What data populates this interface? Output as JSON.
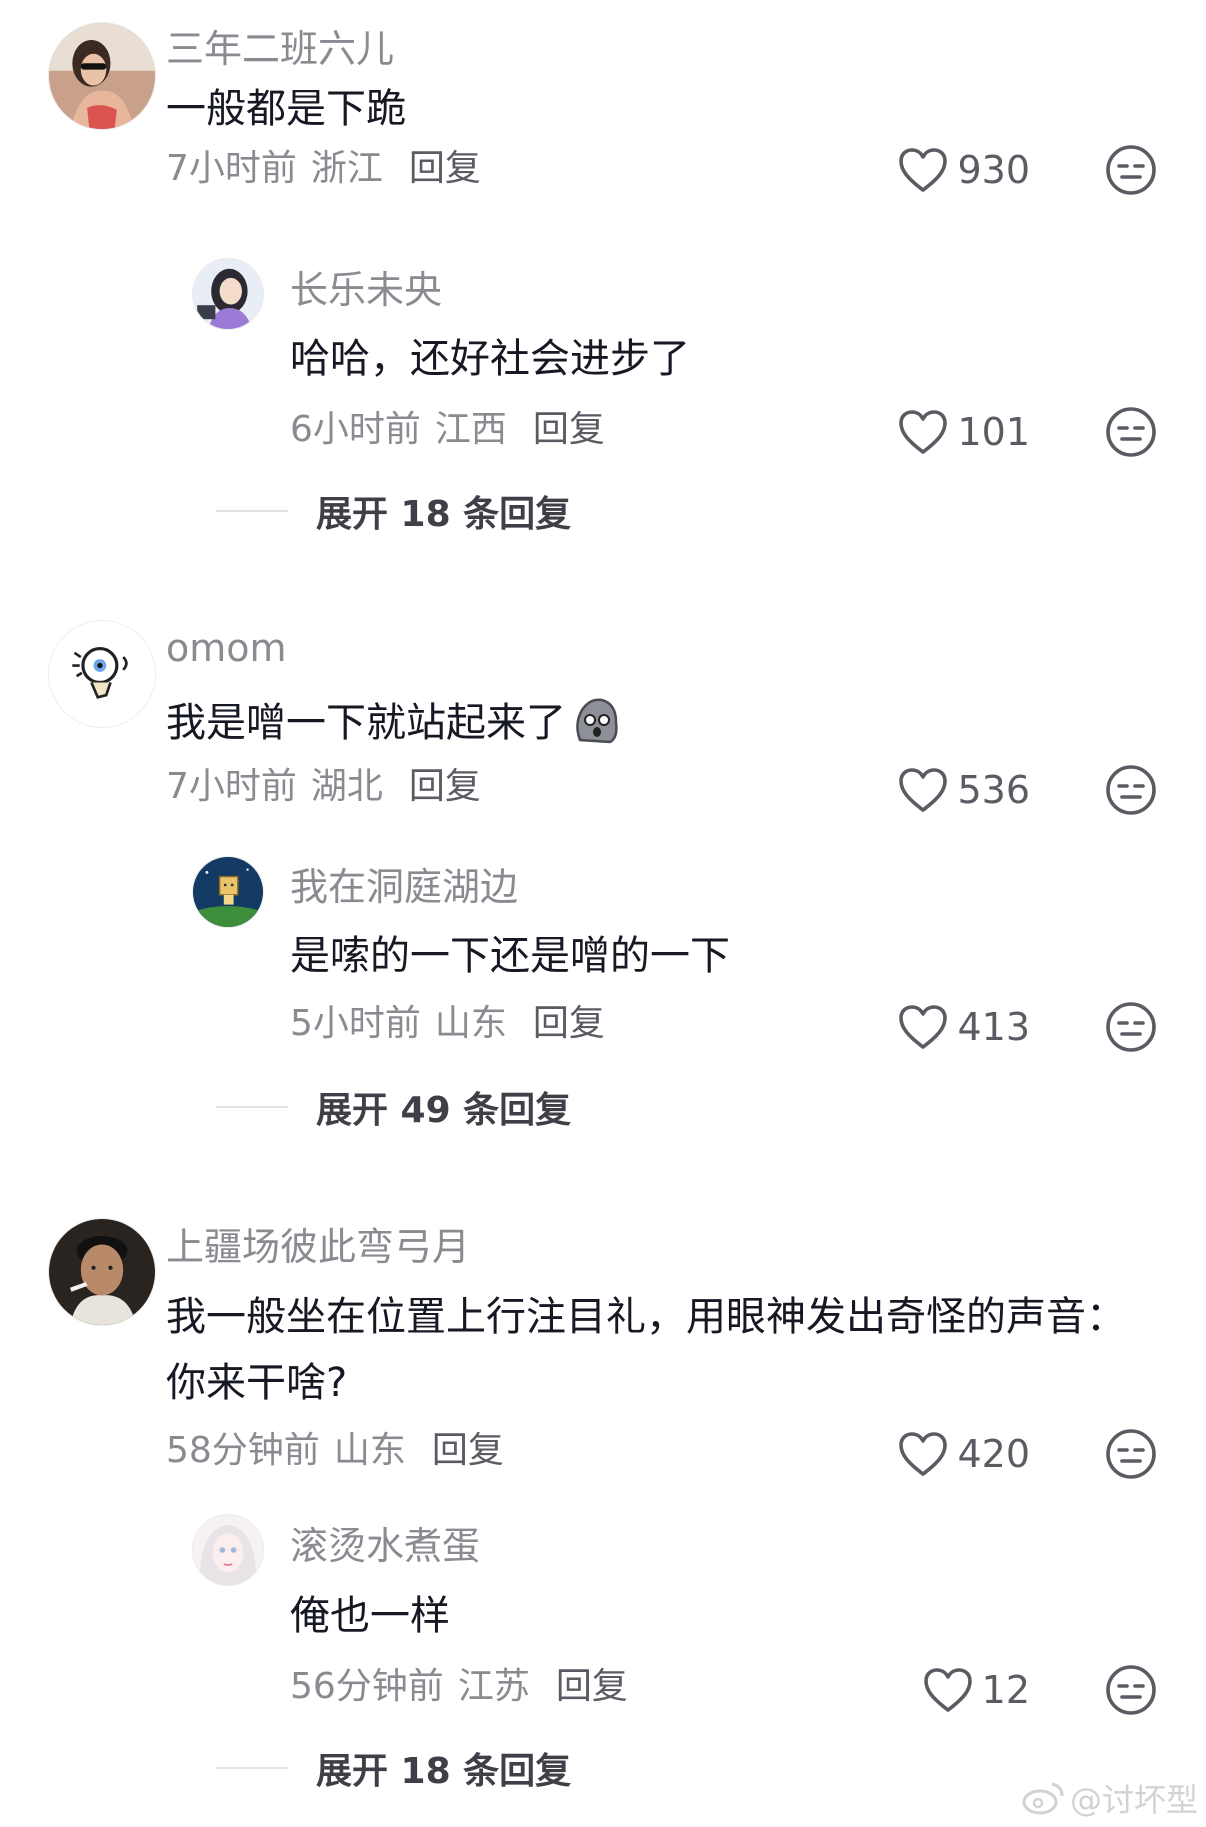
{
  "comments": [
    {
      "user": "三年二班六儿",
      "text": "一般都是下跪",
      "time": "7小时前",
      "location": "浙江",
      "reply_label": "回复",
      "likes": "930",
      "reply": {
        "user": "长乐未央",
        "text": "哈哈，还好社会进步了",
        "time": "6小时前",
        "location": "江西",
        "reply_label": "回复",
        "likes": "101"
      },
      "expand_label": "展开 18 条回复"
    },
    {
      "user": "omom",
      "text": "我是噌一下就站起来了",
      "time": "7小时前",
      "location": "湖北",
      "reply_label": "回复",
      "likes": "536",
      "reply": {
        "user": "我在洞庭湖边",
        "text": "是嗦的一下还是噌的一下",
        "time": "5小时前",
        "location": "山东",
        "reply_label": "回复",
        "likes": "413"
      },
      "expand_label": "展开 49 条回复"
    },
    {
      "user": "上疆场彼此弯弓月",
      "text": "我一般坐在位置上行注目礼，用眼神发出奇怪的声音：你来干啥?",
      "time": "58分钟前",
      "location": "山东",
      "reply_label": "回复",
      "likes": "420",
      "reply": {
        "user": "滚烫水煮蛋",
        "text": "俺也一样",
        "time": "56分钟前",
        "location": "江苏",
        "reply_label": "回复",
        "likes": "12"
      },
      "expand_label": "展开 18 条回复"
    }
  ],
  "watermark": "@讨坏型",
  "icons": {
    "like": "heart-outline-icon",
    "dislike": "unamused-face-icon",
    "emoji": "worried-blob-emoji"
  },
  "colors": {
    "text": "#161823",
    "secondary": "#8a8b91",
    "action": "#5b5c63"
  }
}
